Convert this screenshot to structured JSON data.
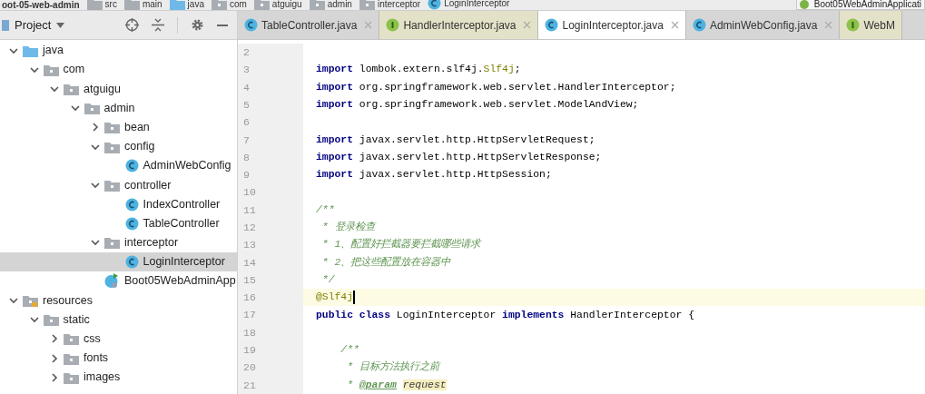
{
  "breadcrumbs": [
    {
      "label": "oot-05-web-admin"
    },
    {
      "label": "src",
      "kind": "folder"
    },
    {
      "label": "main",
      "kind": "folder"
    },
    {
      "label": "java",
      "kind": "source"
    },
    {
      "label": "com",
      "kind": "package"
    },
    {
      "label": "atguigu",
      "kind": "package"
    },
    {
      "label": "admin",
      "kind": "package"
    },
    {
      "label": "interceptor",
      "kind": "package"
    },
    {
      "label": "LoginInterceptor",
      "kind": "class"
    }
  ],
  "run_config": {
    "label": "Boot05WebAdminApplicati"
  },
  "project_panel": {
    "title": "Project"
  },
  "tabs": [
    {
      "label": "TableController.java",
      "kind": "class",
      "selected": false
    },
    {
      "label": "HandlerInterceptor.java",
      "kind": "interface",
      "selected": false
    },
    {
      "label": "LoginInterceptor.java",
      "kind": "class",
      "selected": true
    },
    {
      "label": "AdminWebConfig.java",
      "kind": "class",
      "selected": false
    },
    {
      "label": "WebM",
      "kind": "interface",
      "selected": false
    }
  ],
  "tree": [
    {
      "label": "java",
      "kind": "source",
      "expanded": true,
      "selected": false,
      "children": [
        {
          "label": "com",
          "kind": "package",
          "expanded": true,
          "selected": false,
          "children": [
            {
              "label": "atguigu",
              "kind": "package",
              "expanded": true,
              "selected": false,
              "children": [
                {
                  "label": "admin",
                  "kind": "package",
                  "expanded": true,
                  "selected": false,
                  "children": [
                    {
                      "label": "bean",
                      "kind": "package",
                      "expanded": false,
                      "selected": false
                    },
                    {
                      "label": "config",
                      "kind": "package",
                      "expanded": true,
                      "selected": false,
                      "children": [
                        {
                          "label": "AdminWebConfig",
                          "kind": "class",
                          "selected": false
                        }
                      ]
                    },
                    {
                      "label": "controller",
                      "kind": "package",
                      "expanded": true,
                      "selected": false,
                      "children": [
                        {
                          "label": "IndexController",
                          "kind": "class",
                          "selected": false
                        },
                        {
                          "label": "TableController",
                          "kind": "class",
                          "selected": false
                        }
                      ]
                    },
                    {
                      "label": "interceptor",
                      "kind": "package",
                      "expanded": true,
                      "selected": false,
                      "children": [
                        {
                          "label": "LoginInterceptor",
                          "kind": "class",
                          "selected": true
                        }
                      ]
                    },
                    {
                      "label": "Boot05WebAdminApp",
                      "kind": "app",
                      "selected": false
                    }
                  ]
                }
              ]
            }
          ]
        }
      ]
    },
    {
      "label": "resources",
      "kind": "resources",
      "expanded": true,
      "selected": false,
      "children": [
        {
          "label": "static",
          "kind": "package",
          "expanded": true,
          "selected": false,
          "children": [
            {
              "label": "css",
              "kind": "package",
              "expanded": false,
              "selected": false
            },
            {
              "label": "fonts",
              "kind": "package",
              "expanded": false,
              "selected": false
            },
            {
              "label": "images",
              "kind": "package",
              "expanded": false,
              "selected": false
            }
          ]
        }
      ]
    }
  ],
  "code_lines": [
    {
      "number": "2",
      "current": false
    },
    {
      "number": "3",
      "current": false,
      "tokens": [
        {
          "text": "import",
          "kind": "keyword"
        },
        {
          "text": " lombok.extern.slf4j.",
          "kind": "plain"
        },
        {
          "text": "Slf4j",
          "kind": "annotation"
        },
        {
          "text": ";",
          "kind": "plain"
        }
      ]
    },
    {
      "number": "4",
      "current": false,
      "tokens": [
        {
          "text": "import",
          "kind": "keyword"
        },
        {
          "text": " org.springframework.web.servlet.HandlerInterceptor;",
          "kind": "plain"
        }
      ]
    },
    {
      "number": "5",
      "current": false,
      "tokens": [
        {
          "text": "import",
          "kind": "keyword"
        },
        {
          "text": " org.springframework.web.servlet.ModelAndView;",
          "kind": "plain"
        }
      ]
    },
    {
      "number": "6",
      "current": false
    },
    {
      "number": "7",
      "current": false,
      "tokens": [
        {
          "text": "import",
          "kind": "keyword"
        },
        {
          "text": " javax.servlet.http.HttpServletRequest;",
          "kind": "plain"
        }
      ]
    },
    {
      "number": "8",
      "current": false,
      "tokens": [
        {
          "text": "import",
          "kind": "keyword"
        },
        {
          "text": " javax.servlet.http.HttpServletResponse;",
          "kind": "plain"
        }
      ]
    },
    {
      "number": "9",
      "current": false,
      "tokens": [
        {
          "text": "import",
          "kind": "keyword"
        },
        {
          "text": " javax.servlet.http.HttpSession;",
          "kind": "plain"
        }
      ]
    },
    {
      "number": "10",
      "current": false
    },
    {
      "number": "11",
      "current": false,
      "tokens": [
        {
          "text": "/**",
          "kind": "comment"
        }
      ]
    },
    {
      "number": "12",
      "current": false,
      "tokens": [
        {
          "text": " * 登录检查",
          "kind": "comment"
        }
      ]
    },
    {
      "number": "13",
      "current": false,
      "tokens": [
        {
          "text": " * 1、配置好拦截器要拦截哪些请求",
          "kind": "comment"
        }
      ]
    },
    {
      "number": "14",
      "current": false,
      "tokens": [
        {
          "text": " * 2、把这些配置放在容器中",
          "kind": "comment"
        }
      ]
    },
    {
      "number": "15",
      "current": false,
      "tokens": [
        {
          "text": " */",
          "kind": "comment"
        }
      ]
    },
    {
      "number": "16",
      "current": true,
      "tokens": [
        {
          "text": "@Slf4j",
          "kind": "annotation"
        }
      ]
    },
    {
      "number": "17",
      "current": false,
      "tokens": [
        {
          "text": "public class",
          "kind": "keyword"
        },
        {
          "text": " LoginInterceptor ",
          "kind": "plain"
        },
        {
          "text": "implements",
          "kind": "keyword"
        },
        {
          "text": " HandlerInterceptor {",
          "kind": "plain"
        }
      ]
    },
    {
      "number": "18",
      "current": false
    },
    {
      "number": "19",
      "current": false,
      "tokens": [
        {
          "text": "    /**",
          "kind": "comment"
        }
      ]
    },
    {
      "number": "20",
      "current": false,
      "tokens": [
        {
          "text": "     * 目标方法执行之前",
          "kind": "comment"
        }
      ]
    },
    {
      "number": "21",
      "current": false,
      "tokens": [
        {
          "text": "     * ",
          "kind": "comment"
        },
        {
          "text": "@param",
          "kind": "doctag"
        },
        {
          "text": "request",
          "kind": "docparam"
        }
      ]
    }
  ]
}
